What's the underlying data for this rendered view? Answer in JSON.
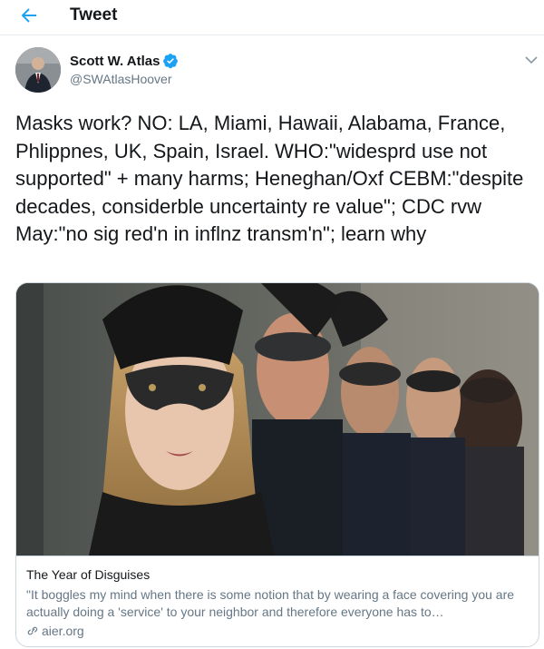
{
  "header": {
    "title": "Tweet",
    "back_icon": "back-arrow-icon"
  },
  "author": {
    "name": "Scott W. Atlas",
    "handle": "@SWAtlasHoover",
    "verified": true,
    "verified_icon": "verified-badge-icon",
    "avatar": "avatar"
  },
  "tweet": {
    "text": "Masks work? NO: LA, Miami, Hawaii, Alabama, France, Phlippnes, UK, Spain, Israel. WHO:\"widesprd use not supported\" + many harms; Heneghan/Oxf CEBM:\"despite decades, considerble uncertainty re value\"; CDC rvw May:\"no sig red'n in inflnz transm'n\"; learn why"
  },
  "card": {
    "title": "The Year of Disguises",
    "description": "\"It boggles my mind when there is some notion that by wearing a face covering you are actually doing a 'service' to your neighbor and therefore everyone has to…",
    "domain": "aier.org",
    "link_icon": "link-icon"
  },
  "colors": {
    "accent": "#1da1f2",
    "text": "#14171a",
    "secondary": "#657786",
    "border": "#ccd6dd"
  }
}
